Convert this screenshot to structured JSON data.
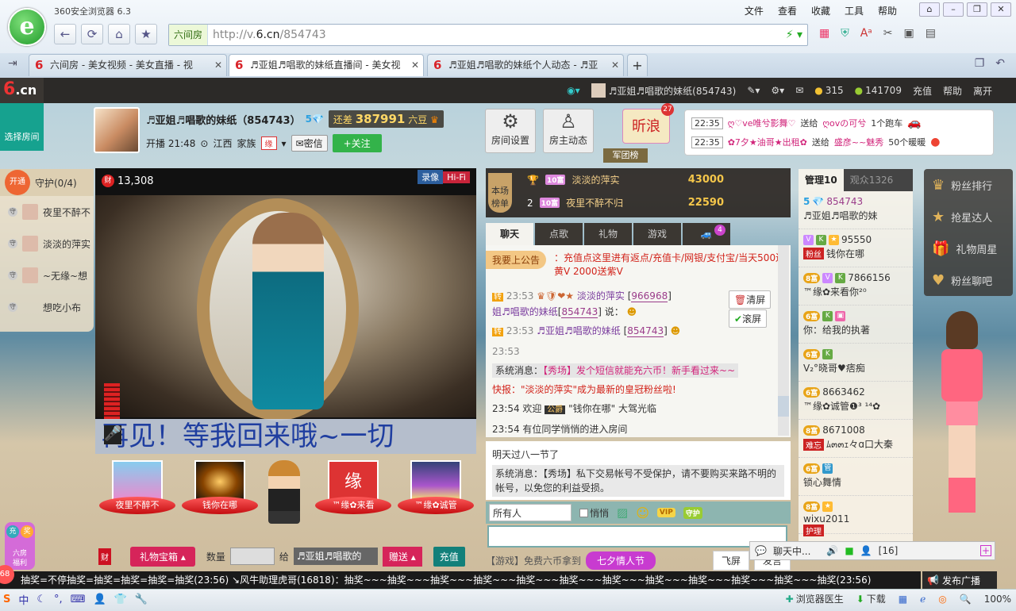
{
  "browser": {
    "title": "360安全浏览器 6.3",
    "menu": [
      "文件",
      "查看",
      "收藏",
      "工具",
      "帮助"
    ],
    "address_tag": "六间房",
    "url_prefix": "http://v.",
    "url_domain": "6.cn",
    "url_path": "/854743",
    "tabs": [
      {
        "label": "六间房 - 美女视频 - 美女直播 - 视"
      },
      {
        "label": "♬亚姐♬唱歌的妹纸直播间 - 美女视"
      },
      {
        "label": "♬亚姐♬唱歌的妹纸个人动态 - ♬亚"
      }
    ],
    "tab_close": "✕",
    "new_tab": "+"
  },
  "site": {
    "logo": "6",
    "logo_suffix": ".cn",
    "user_name": "♬亚姐♬唱歌的妹纸(854743)",
    "coins": "315",
    "beans": "141709",
    "nav": [
      "充值",
      "帮助",
      "离开"
    ],
    "select_room": "选择房间"
  },
  "anchor": {
    "name": "♬亚姐♬唱歌的妹纸（854743）",
    "level": "5",
    "gap_label": "还差",
    "gap_value": "387991",
    "gap_unit": "六豆",
    "start": "开播 21:48",
    "location": "江西",
    "family": "家族",
    "family_badge": "缘",
    "message": "密信",
    "follow": "+关注",
    "room_settings": "房间设置",
    "host_feed": "房主动态",
    "weibo": "昕浪",
    "weibo_count": "27",
    "junbang": "军团榜"
  },
  "gift_feed": [
    {
      "time": "22:35",
      "from": "ღ♡ve唯兮影舞♡",
      "verb": "送给",
      "to": "ღovの可兮",
      "item": "1个跑车"
    },
    {
      "time": "22:35",
      "from": "✿7夕★油哥★出租✿",
      "verb": "送给",
      "to": "盛彦~~魅秀",
      "item": "50个暖暖"
    }
  ],
  "guard": {
    "open": "开通",
    "title": "守护(0/4)",
    "items": [
      "夜里不醉不",
      "淡淡的萍实",
      "~无缘~想",
      "想吃小布"
    ]
  },
  "video": {
    "wealth": "13,308",
    "record": "录像",
    "hifi": "Hi-Fi",
    "marquee": "再见！等我回来哦~一切"
  },
  "fans": [
    {
      "name": "夜里不醉不"
    },
    {
      "name": "钱你在哪"
    },
    {
      "name": ""
    },
    {
      "name": "™缘✿来看"
    },
    {
      "name": "™缘✿诚管"
    }
  ],
  "gift_bar": {
    "gift_box": "礼物宝箱",
    "qty_label": "数量",
    "to_label": "给",
    "to_value": "♬亚姐♬唱歌的",
    "send": "赠送",
    "recharge": "充值"
  },
  "side_buttons": [
    "充",
    "奖",
    "六房",
    "福利"
  ],
  "rank": {
    "tag": "本场榜单",
    "rows": [
      {
        "pos": "1",
        "lvl": "10富",
        "name": "淡淡的萍实",
        "coins": "43000"
      },
      {
        "pos": "2",
        "lvl": "10富",
        "name": "夜里不醉不归",
        "coins": "22590"
      }
    ]
  },
  "chat_tabs": [
    "聊天",
    "点歌",
    "礼物",
    "游戏"
  ],
  "chat_tab_badge": "4",
  "chat": {
    "announce_tag": "我要上公告",
    "announce_text": "：充值点这里进有返点/充值卡/网银/支付宝/当天500送黄V 2000送紫V",
    "lines": [
      {
        "time": "23:53",
        "name": "淡淡的萍实",
        "id": "966968",
        "text2": "姐♬唱歌的妹纸",
        "id2": "854743",
        "tail": "说："
      },
      {
        "time": "23:53",
        "name": "♬亚姐♬唱歌的妹纸",
        "id": "854743"
      }
    ],
    "time_only": "23:53",
    "sys_label": "系统消息：",
    "sys_text": "【秀场】发个短信就能充六币！新手看过来~~",
    "flash": "快报：\"淡淡的萍实\"成为最新的皇冠粉丝啦!",
    "welcome_time": "23:54",
    "welcome_pre": "欢迎",
    "welcome_name": "\"钱你在哪\"",
    "welcome_post": "大驾光临",
    "enter_time": "23:54",
    "enter_text": "有位同学悄悄的进入房间",
    "clear": "清屏",
    "scroll": "滚屏"
  },
  "chat2": {
    "line1": "明天过八一节了",
    "sys_label": "系统消息：",
    "sys_text": "【秀场】私下交易帐号不受保护，请不要购买来路不明的帐号，以免您的利益受损。"
  },
  "chat_tools": {
    "who": "所有人",
    "whisper": "悄悄",
    "vip": "VIP",
    "guard": "守护"
  },
  "chat_bottom": {
    "game": "【游戏】免费六币拿到",
    "valentine": "七夕情人节",
    "fly": "飞屏",
    "send": "发言"
  },
  "users": {
    "tab_admin": "管理10",
    "tab_audience": "观众1326",
    "items": [
      {
        "rank": "5",
        "num": "854743",
        "name": "♬亚姐♬唱歌的妹"
      },
      {
        "rank": "",
        "num": "95550",
        "name": "钱你在哪",
        "tag": "粉丝"
      },
      {
        "rank": "8富",
        "num": "7866156",
        "name": "™缘✿来看你²⁰"
      },
      {
        "rank": "6富",
        "num": "",
        "name": "你：给我的执著"
      },
      {
        "rank": "6富",
        "num": "",
        "name": "V₂°晓哥♥痞痴"
      },
      {
        "rank": "6富",
        "num": "8663462",
        "name": "™缘✿诚管❶³ ¹⁴✿"
      },
      {
        "rank": "8富",
        "num": "8671008",
        "name": "ﾑ๓๓ｪ々ɑ口大秦",
        "tag": "难忘"
      },
      {
        "rank": "6富",
        "num": "",
        "name": "锁心舞情"
      },
      {
        "rank": "8富",
        "num": "wixu2011",
        "name": "",
        "tag": "护理"
      }
    ]
  },
  "right_menu": [
    {
      "icon": "crown-icon",
      "label": "粉丝排行"
    },
    {
      "icon": "star-icon",
      "label": "抢星达人"
    },
    {
      "icon": "gift-icon",
      "label": "礼物周星"
    },
    {
      "icon": "heart-icon",
      "label": "粉丝聊吧"
    }
  ],
  "mini_chat": {
    "label": "聊天中...",
    "count": "[16]"
  },
  "ticker": "抽奖=不停抽奖=抽奖=抽奖=抽奖=抽奖(23:56)    ↘风牛助理虎哥(16818)：抽奖~~~抽奖~~~抽奖~~~抽奖~~~抽奖~~~抽奖~~~抽奖~~~抽奖~~~抽奖~~~抽奖~~~抽奖~~~抽奖(23:56)",
  "broadcast": "发布广播",
  "badge68": "68",
  "statusbar": {
    "left": "中",
    "doctor": "浏览器医生",
    "download": "下载",
    "zoom": "100%"
  }
}
